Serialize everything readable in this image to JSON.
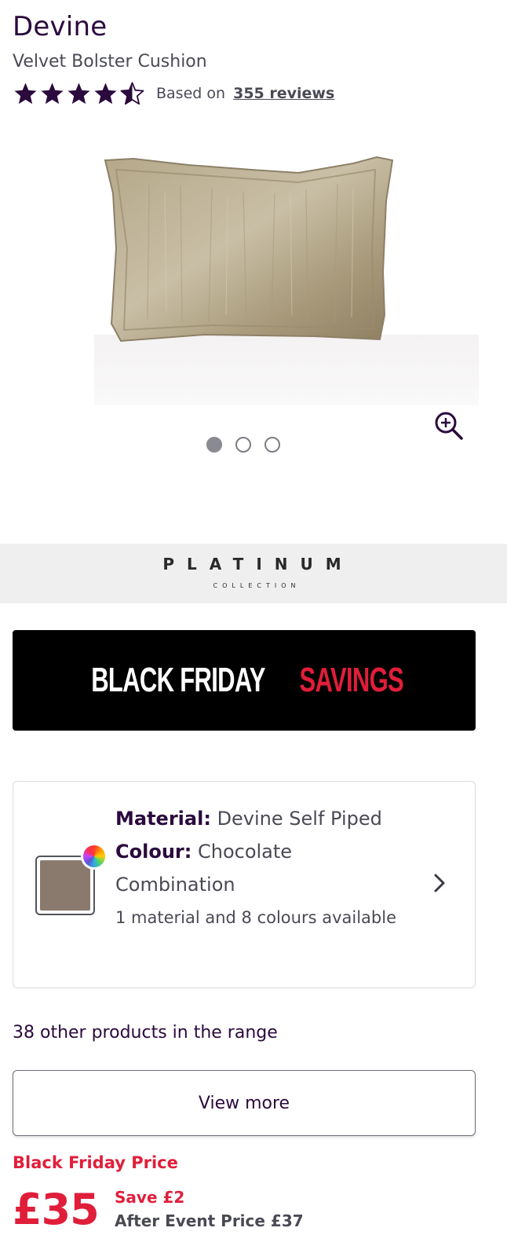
{
  "product": {
    "brand": "Devine",
    "name": "Velvet Bolster Cushion",
    "rating": 4.5,
    "rating_max": 5,
    "reviews_prefix": "Based on",
    "reviews_link": "355 reviews"
  },
  "gallery": {
    "image_icon": "cushion-image",
    "zoom_icon": "zoom-in-icon",
    "slide_count": 3,
    "active_slide": 1
  },
  "collection_banner": {
    "title": "PLATINUM",
    "subtitle": "COLLECTION"
  },
  "promo_banner": {
    "text_white": "BLACK FRIDAY",
    "text_red": "SAVINGS",
    "colors": {
      "background": "#000000",
      "red": "#e01e3a"
    }
  },
  "options": {
    "material_label": "Material:",
    "material_value": "Devine Self Piped",
    "colour_label": "Colour:",
    "colour_value": "Chocolate Combination",
    "availability": "1 material and 8 colours available",
    "swatch_color": "#8a7a6e",
    "icons": [
      "colour-wheel-icon",
      "chevron-right-icon"
    ]
  },
  "range": {
    "text": "38 other products in the range",
    "button_label": "View more"
  },
  "pricing": {
    "label": "Black Friday Price",
    "price": "£35",
    "save": "Save £2",
    "after_event": "After Event Price £37",
    "accent_color": "#e01e3a"
  },
  "colors": {
    "brand_purple": "#2b0a3d",
    "text_gray": "#4a4a55",
    "banner_gray": "#efefef"
  }
}
